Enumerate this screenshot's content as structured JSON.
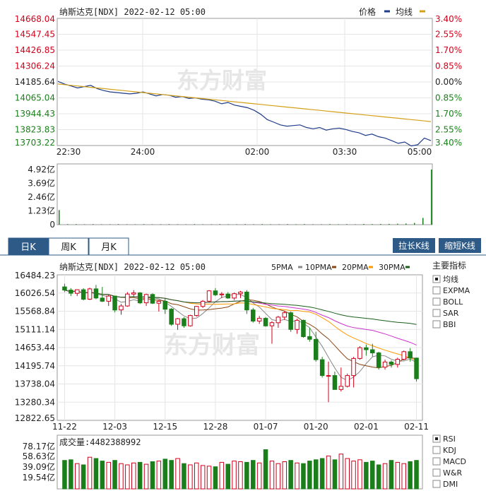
{
  "colors": {
    "red": "#d0021b",
    "green": "#1a7f1a",
    "price_line": "#1f3c88",
    "avg_line": "#d4a017",
    "ma5": "#888888",
    "ma10": "#8b4513",
    "ma20": "#ff9900",
    "ma30": "#cc33cc",
    "ma60": "#1a5e1a",
    "tab_active": "#2d5a87",
    "button_bg": "#2d5a87"
  },
  "intraday": {
    "title": "纳斯达克[NDX] 2022-02-12 05:00",
    "legend": {
      "price_label": "价格",
      "avg_label": "均线"
    },
    "price_ticks": [
      "14668.04",
      "14547.45",
      "14426.85",
      "14306.24",
      "14185.64",
      "14065.04",
      "13944.43",
      "13823.83",
      "13703.22"
    ],
    "pct_ticks": [
      "3.40%",
      "2.55%",
      "1.70%",
      "0.85%",
      "0.00%",
      "0.85%",
      "1.70%",
      "2.55%",
      "3.40%"
    ],
    "time_ticks": [
      "22:30",
      "24:00",
      "02:00",
      "03:30",
      "05:00"
    ],
    "volume_ticks": [
      "4.92亿",
      "3.69亿",
      "2.46亿",
      "1.23亿",
      "0"
    ],
    "watermark": "东方财富"
  },
  "tabs": [
    {
      "label": "日K",
      "active": true
    },
    {
      "label": "周K",
      "active": false
    },
    {
      "label": "月K",
      "active": false
    }
  ],
  "buttons": {
    "stretch": "拉长K线",
    "shrink": "缩短K线"
  },
  "kline": {
    "title": "纳斯达克[NDX] 2022-02-12 05:00",
    "ma_legend": [
      "5PMA",
      "10PMA",
      "20PMA",
      "30PMA"
    ],
    "price_ticks": [
      "16484.23",
      "16026.54",
      "15568.84",
      "15111.14",
      "14653.44",
      "14195.74",
      "13738.04",
      "13280.34",
      "12822.65"
    ],
    "date_ticks": [
      "11-22",
      "12-03",
      "12-15",
      "12-28",
      "01-07",
      "01-20",
      "02-01",
      "02-11"
    ],
    "volume_label": "成交量:4482388992",
    "volume_ticks": [
      "78.17亿",
      "58.63亿",
      "39.09亿",
      "19.54亿"
    ]
  },
  "indicators": {
    "header": "主要指标",
    "main": [
      {
        "label": "均线",
        "checked": true
      },
      {
        "label": "EXPMA",
        "checked": false
      },
      {
        "label": "BOLL",
        "checked": false
      },
      {
        "label": "SAR",
        "checked": false
      },
      {
        "label": "BBI",
        "checked": false
      }
    ],
    "sub": [
      {
        "label": "RSI",
        "checked": true
      },
      {
        "label": "KDJ",
        "checked": false
      },
      {
        "label": "MACD",
        "checked": false
      },
      {
        "label": "W&R",
        "checked": false
      },
      {
        "label": "DMI",
        "checked": false
      }
    ]
  },
  "chart_data": [
    {
      "type": "line",
      "title": "纳斯达克[NDX] 2022-02-12 05:00",
      "ylim": [
        13703.22,
        14668.04
      ],
      "series": [
        {
          "name": "价格",
          "values": [
            14190,
            14170,
            14155,
            14140,
            14150,
            14160,
            14135,
            14120,
            14110,
            14105,
            14100,
            14095,
            14100,
            14110,
            14095,
            14080,
            14090,
            14085,
            14070,
            14075,
            14060,
            14065,
            14055,
            14050,
            14040,
            14020,
            14030,
            14010,
            14000,
            13990,
            13970,
            13940,
            13900,
            13880,
            13860,
            13850,
            13855,
            13860,
            13840,
            13830,
            13840,
            13820,
            13830,
            13835,
            13825,
            13810,
            13800,
            13780,
            13790,
            13770,
            13760,
            13740,
            13720,
            13730,
            13700,
            13710,
            13760,
            13740
          ]
        },
        {
          "name": "均线",
          "values": [
            14170,
            14165,
            14160,
            14155,
            14150,
            14145,
            14140,
            14135,
            14130,
            14125,
            14120,
            14115,
            14110,
            14105,
            14100,
            14095,
            14090,
            14085,
            14080,
            14075,
            14070,
            14065,
            14060,
            14055,
            14050,
            14045,
            14040,
            14035,
            14030,
            14025,
            14020,
            14015,
            14010,
            14005,
            14000,
            13995,
            13990,
            13985,
            13980,
            13975,
            13970,
            13965,
            13960,
            13955,
            13950,
            13945,
            13940,
            13935,
            13930,
            13925,
            13920,
            13915,
            13910,
            13905,
            13900,
            13895,
            13890,
            13885
          ]
        }
      ]
    },
    {
      "type": "bar",
      "title": "",
      "ylim": [
        0,
        4.92
      ],
      "values": [
        1.3,
        0.05,
        0.05,
        0.04,
        0.05,
        0.04,
        0.04,
        0.05,
        0.04,
        0.04,
        0.05,
        0.04,
        0.04,
        0.05,
        0.04,
        0.04,
        0.05,
        0.04,
        0.04,
        0.05,
        0.04,
        0.04,
        0.05,
        0.04,
        0.05,
        0.04,
        0.04,
        0.05,
        0.04,
        0.05,
        0.04,
        0.04,
        0.05,
        0.04,
        0.05,
        0.04,
        0.06,
        0.05,
        0.06,
        0.07,
        0.08,
        0.1,
        0.15,
        0.6,
        4.92
      ]
    },
    {
      "type": "candlestick",
      "title": "纳斯达克[NDX] 2022-02-12 05:00",
      "ylim": [
        12822.65,
        16484.23
      ],
      "x": [
        "11-22",
        "11-23",
        "11-24",
        "11-26",
        "11-29",
        "11-30",
        "12-01",
        "12-02",
        "12-03",
        "12-06",
        "12-07",
        "12-08",
        "12-09",
        "12-10",
        "12-13",
        "12-14",
        "12-15",
        "12-16",
        "12-17",
        "12-20",
        "12-21",
        "12-22",
        "12-23",
        "12-27",
        "12-28",
        "12-29",
        "12-30",
        "12-31",
        "01-03",
        "01-04",
        "01-05",
        "01-06",
        "01-07",
        "01-10",
        "01-11",
        "01-12",
        "01-13",
        "01-14",
        "01-18",
        "01-19",
        "01-20",
        "01-21",
        "01-24",
        "01-25",
        "01-26",
        "01-27",
        "01-28",
        "01-31",
        "02-01",
        "02-02",
        "02-03",
        "02-04",
        "02-07",
        "02-08",
        "02-09",
        "02-10",
        "02-11"
      ],
      "ohlc": [
        [
          16180,
          16260,
          16050,
          16100
        ],
        [
          16100,
          16150,
          15950,
          16020
        ],
        [
          16020,
          16120,
          15950,
          16110
        ],
        [
          16110,
          16150,
          15840,
          15870
        ],
        [
          15870,
          16160,
          15850,
          16130
        ],
        [
          16130,
          16230,
          15870,
          15900
        ],
        [
          15900,
          16180,
          15800,
          15820
        ],
        [
          15820,
          15980,
          15700,
          15950
        ],
        [
          15950,
          15960,
          15540,
          15600
        ],
        [
          15600,
          15750,
          15480,
          15700
        ],
        [
          15700,
          16050,
          15680,
          16000
        ],
        [
          16000,
          16100,
          15940,
          16030
        ],
        [
          16030,
          16050,
          15750,
          15780
        ],
        [
          15780,
          16010,
          15700,
          15990
        ],
        [
          15990,
          16020,
          15750,
          15770
        ],
        [
          15770,
          15850,
          15560,
          15820
        ],
        [
          15820,
          15900,
          15500,
          15620
        ],
        [
          15620,
          15650,
          15200,
          15240
        ],
        [
          15240,
          15400,
          15100,
          15380
        ],
        [
          15380,
          15420,
          15150,
          15200
        ],
        [
          15200,
          15480,
          15180,
          15460
        ],
        [
          15460,
          15700,
          15430,
          15690
        ],
        [
          15690,
          15850,
          15650,
          15820
        ],
        [
          15820,
          16100,
          15800,
          16080
        ],
        [
          16080,
          16150,
          15950,
          15980
        ],
        [
          15980,
          16050,
          15900,
          16000
        ],
        [
          16000,
          16050,
          15880,
          15900
        ],
        [
          15900,
          16040,
          15850,
          16010
        ],
        [
          16010,
          16080,
          15900,
          16050
        ],
        [
          16050,
          16100,
          15500,
          15600
        ],
        [
          15600,
          15650,
          15280,
          15320
        ],
        [
          15320,
          15450,
          15250,
          15390
        ],
        [
          15390,
          15420,
          15180,
          15200
        ],
        [
          15200,
          15320,
          14750,
          15280
        ],
        [
          15280,
          15450,
          15150,
          15420
        ],
        [
          15420,
          15580,
          15350,
          15530
        ],
        [
          15530,
          15560,
          15050,
          15110
        ],
        [
          15110,
          15380,
          15000,
          15340
        ],
        [
          15340,
          15360,
          14900,
          14930
        ],
        [
          14930,
          15150,
          14800,
          14860
        ],
        [
          14860,
          15050,
          14300,
          14350
        ],
        [
          14350,
          14420,
          13900,
          13950
        ],
        [
          13950,
          14300,
          13280,
          13950
        ],
        [
          13950,
          14050,
          13600,
          13600
        ],
        [
          13600,
          14150,
          13550,
          13680
        ],
        [
          13680,
          14000,
          13650,
          13950
        ],
        [
          13950,
          14420,
          13650,
          14380
        ],
        [
          14380,
          14690,
          14350,
          14650
        ],
        [
          14650,
          14730,
          14450,
          14600
        ],
        [
          14600,
          14750,
          14430,
          14520
        ],
        [
          14520,
          14550,
          14100,
          14160
        ],
        [
          14160,
          14350,
          14100,
          14290
        ],
        [
          14290,
          14330,
          14150,
          14230
        ],
        [
          14230,
          14400,
          14150,
          14360
        ],
        [
          14360,
          14580,
          14330,
          14550
        ],
        [
          14550,
          14640,
          14300,
          14390
        ],
        [
          14390,
          14400,
          13800,
          13870
        ]
      ]
    },
    {
      "type": "bar",
      "title": "成交量:4482388992",
      "ylim": [
        0,
        78.17
      ],
      "values": [
        45,
        46,
        40,
        38,
        50,
        48,
        44,
        42,
        45,
        40,
        38,
        41,
        42,
        39,
        43,
        44,
        47,
        45,
        48,
        40,
        38,
        41,
        37,
        36,
        35,
        42,
        39,
        44,
        43,
        42,
        45,
        41,
        62,
        44,
        40,
        43,
        45,
        41,
        40,
        44,
        46,
        48,
        52,
        46,
        55,
        48,
        44,
        46,
        42,
        44,
        38,
        40,
        45,
        42,
        40,
        43,
        45
      ]
    }
  ]
}
